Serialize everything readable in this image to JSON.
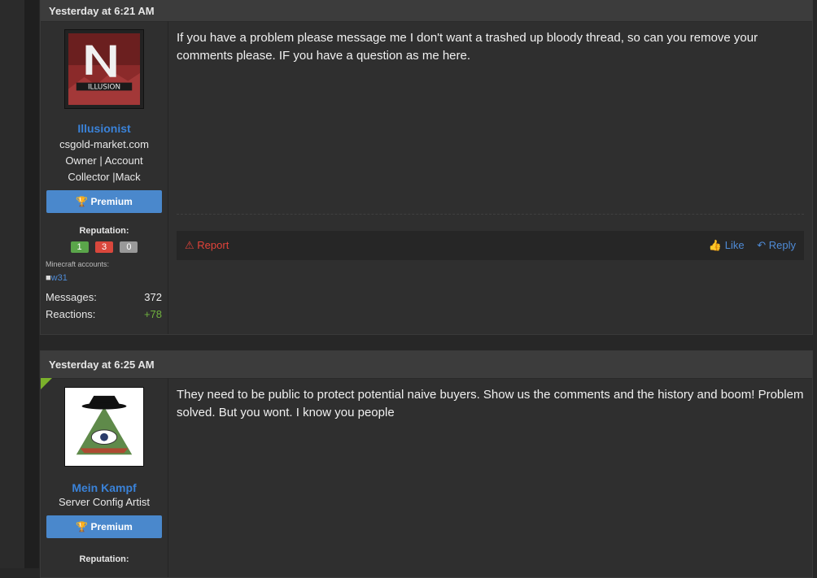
{
  "posts": [
    {
      "timestamp": "Yesterday at 6:21 AM",
      "username": "Illusionist",
      "user_title_lines": [
        "csgold-market.com",
        "Owner | Account",
        "Collector |Mack"
      ],
      "avatar_icon": "illusion-logo-icon",
      "premium_label": "Premium",
      "reputation_label": "Reputation:",
      "reputation": {
        "positive": "1",
        "negative": "3",
        "neutral": "0"
      },
      "minecraft_label": "Minecraft accounts:",
      "minecraft_account": "w31",
      "messages_label": "Messages:",
      "messages_value": "372",
      "reactions_label": "Reactions:",
      "reactions_value": "+78",
      "message": "If you have a problem please message me I don't want a trashed up bloody thread, so can you remove your comments please. IF you have a question as me here.",
      "report_label": "Report",
      "like_label": "Like",
      "reply_label": "Reply"
    },
    {
      "timestamp": "Yesterday at 6:25 AM",
      "username": "Mein Kampf",
      "user_title_lines": [
        "Server Config Artist"
      ],
      "avatar_icon": "illuminati-eye-hat-icon",
      "premium_label": "Premium",
      "reputation_label": "Reputation:",
      "message": "They need to be public to protect potential naive buyers. Show us the comments and the history and boom! Problem solved. But you wont. I know you people"
    }
  ],
  "colors": {
    "accent": "#4a88cc",
    "username": "#3a82d8",
    "report": "#e2433a",
    "positive": "#6fb13f"
  }
}
